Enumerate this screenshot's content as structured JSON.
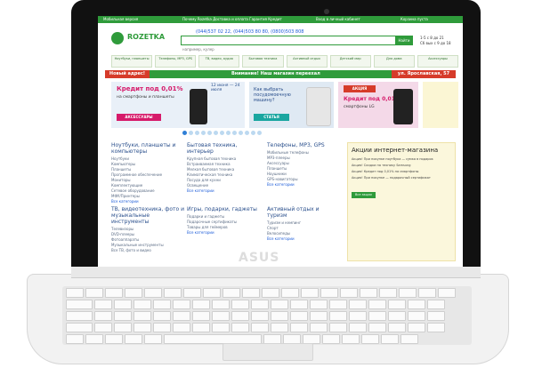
{
  "device": {
    "brand": "ASUS",
    "screen_background": "#ffffff",
    "accent_green": "#2f9b3b",
    "accent_red": "#d63b2a"
  },
  "site": {
    "topbar": {
      "left": "Мобильная версия",
      "center": "Почему Rozetka Доставка и оплата Гарантия Кредит",
      "right": "Вход в личный кабинет",
      "cart": "Корзина пуста"
    },
    "logo": "ROZETKA",
    "phones": "(044)537 02 22, (044)503 80 80, (0800)503 808",
    "search": {
      "button": "Найти",
      "hint": "например, кулер"
    },
    "hours": [
      "1-5 с 8 до 21",
      "Сб вых с 9 до 18"
    ],
    "categories": [
      "Ноутбуки, планшеты",
      "Телефоны, MP3, GPS",
      "ТВ, видео, аудио",
      "Бытовая техника",
      "Активный отдых",
      "Детский мир",
      "Для дома",
      "Аксессуары"
    ],
    "notice": {
      "left": "Новый адрес!",
      "middle": "Внимание! Наш магазин переехал",
      "right": "ул. Ярославская, 57"
    },
    "banners": {
      "credit_left": {
        "title": "Кредит под 0,01%",
        "subtitle": "на смартфоны и планшеты",
        "button": "АКСЕССУАРЫ"
      },
      "dates": "12 июня — 24 июля",
      "article": {
        "title": "Как выбрать посудомоечную машину?",
        "button": "СТАТЬЯ"
      },
      "promo": {
        "title": "АКЦИЯ",
        "subtitle": "Кредит под 0,01%",
        "note": "смартфоны LG"
      }
    },
    "columns": [
      {
        "title": "Ноутбуки, планшеты и компьютеры",
        "items": [
          "Ноутбуки",
          "Компьютеры",
          "Планшеты",
          "Программное обеспечение",
          "Мониторы",
          "Комплектующие",
          "Сетевое оборудование",
          "МФУ/Принтеры"
        ],
        "more": "Все категории"
      },
      {
        "title": "Бытовая техника, интерьер",
        "items": [
          "Крупная бытовая техника",
          "Встраиваемая техника",
          "Мелкая бытовая техника",
          "Климатическая техника",
          "Посуда для кухни",
          "Освещение"
        ],
        "more": "Все категории"
      },
      {
        "title": "Телефоны, MP3, GPS",
        "items": [
          "Мобильные телефоны",
          "MP3-плееры",
          "Аксессуары",
          "Планшеты",
          "Наушники",
          "GPS-навигаторы"
        ],
        "more": "Все категории"
      },
      {
        "title": "ТВ, видеотехника, фото и музыкальные инструменты",
        "items": [
          "Телевизоры",
          "DVD-плееры",
          "Фотоаппараты",
          "Музыкальные инструменты",
          "Все ТВ, фото и видео"
        ],
        "more": ""
      },
      {
        "title": "Игры, подарки, гаджеты",
        "items": [
          "Подарки и гаджеты",
          "Подарочные сертификаты",
          "Товары для геймеров"
        ],
        "more": "Все категории"
      },
      {
        "title": "Активный отдых и туризм",
        "items": [
          "Туризм и кемпинг",
          "Спорт",
          "Велосипеды"
        ],
        "more": "Все категории"
      }
    ],
    "sidebox": {
      "title": "Акции интернет-магазина",
      "items": [
        "Акция! При покупке ноутбука — сумка в подарок",
        "Акция! Скидки на технику Samsung",
        "Акция! Кредит под 0,01% на смартфоны",
        "Акция! При покупке — подарочный сертификат"
      ],
      "button": "Все акции"
    }
  }
}
